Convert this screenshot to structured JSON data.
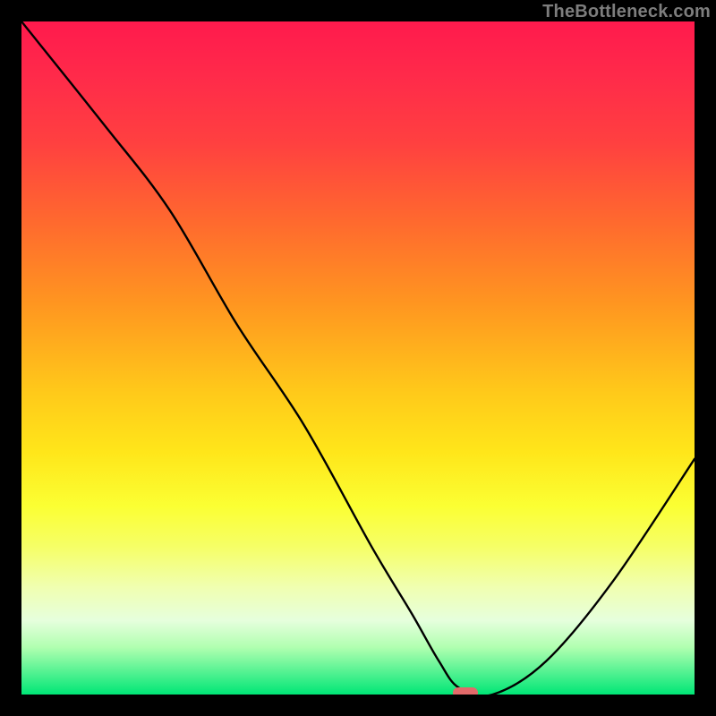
{
  "watermark": "TheBottleneck.com",
  "chart_data": {
    "type": "line",
    "title": "",
    "xlabel": "",
    "ylabel": "",
    "xlim": [
      0,
      100
    ],
    "ylim": [
      0,
      100
    ],
    "grid": false,
    "legend": false,
    "marker": {
      "x": 66,
      "y": 0,
      "color": "#e26a6a"
    },
    "series": [
      {
        "name": "bottleneck-curve",
        "x": [
          0,
          12,
          22,
          32,
          42,
          52,
          58,
          62,
          65,
          70,
          78,
          88,
          100
        ],
        "y": [
          100,
          85,
          72,
          55,
          40,
          22,
          12,
          5,
          1,
          0,
          5,
          17,
          35
        ]
      }
    ],
    "background_gradient_stops": [
      {
        "pos": 0.0,
        "color": "#ff1a4d"
      },
      {
        "pos": 0.18,
        "color": "#ff4040"
      },
      {
        "pos": 0.42,
        "color": "#ff9620"
      },
      {
        "pos": 0.64,
        "color": "#ffe61a"
      },
      {
        "pos": 0.84,
        "color": "#f0ffb0"
      },
      {
        "pos": 1.0,
        "color": "#00e676"
      }
    ]
  }
}
